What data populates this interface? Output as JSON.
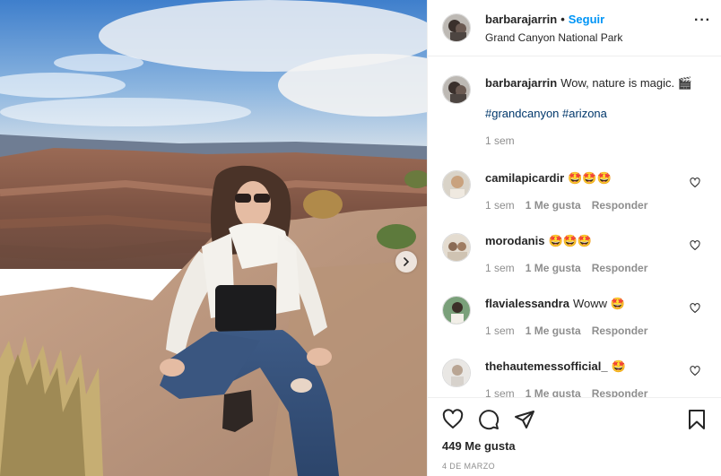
{
  "post": {
    "username": "barbarajarrin",
    "dot": "•",
    "follow_label": "Seguir",
    "location": "Grand Canyon National Park",
    "more_icon": "more-horizontal-icon",
    "next_icon": "chevron-right-icon"
  },
  "caption": {
    "username": "barbarajarrin",
    "text": "Wow, nature is magic. 🎬",
    "hashtags": "#grandcanyon #arizona",
    "time": "1 sem"
  },
  "comments": [
    {
      "username": "camilapicardir",
      "text": "🤩🤩🤩",
      "time": "1 sem",
      "likes": "1 Me gusta",
      "reply": "Responder"
    },
    {
      "username": "morodanis",
      "text": "🤩🤩🤩",
      "time": "1 sem",
      "likes": "1 Me gusta",
      "reply": "Responder"
    },
    {
      "username": "flavialessandra",
      "text": "Woww 🤩",
      "time": "1 sem",
      "likes": "1 Me gusta",
      "reply": "Responder"
    },
    {
      "username": "thehautemessofficial_",
      "text": "🤩",
      "time": "1 sem",
      "likes": "1 Me gusta",
      "reply": "Responder"
    }
  ],
  "actions": {
    "icons": [
      "heart-icon",
      "comment-icon",
      "share-icon",
      "bookmark-icon"
    ],
    "likes_count": "449 Me gusta",
    "date": "4 DE MARZO"
  },
  "colors": {
    "follow": "#0095f6",
    "hashtag": "#00376b",
    "muted": "#8e8e8e",
    "text": "#262626"
  }
}
